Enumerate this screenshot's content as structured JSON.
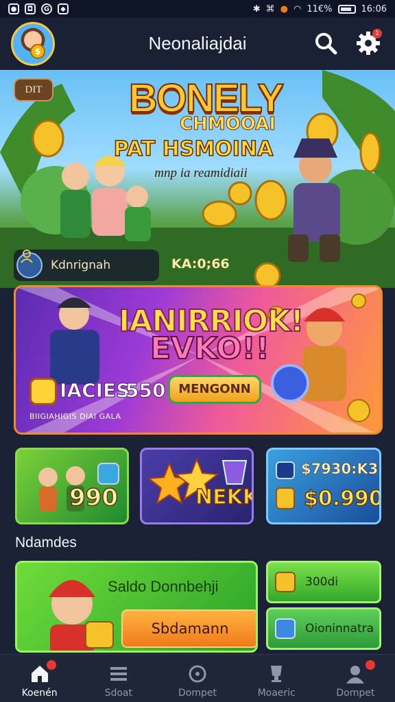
{
  "status_bar": {
    "left_icons": [
      "notification-icon",
      "app-icon",
      "google-icon",
      "messenger-icon"
    ],
    "right_text": "11€%",
    "time": "16:06"
  },
  "header": {
    "title": "Neonaliajdai",
    "search_icon": "search-icon",
    "settings_icon": "gear-icon",
    "settings_badge": "1"
  },
  "hero": {
    "tag": "DIT",
    "title": "BONELY",
    "subtitle_1": "CHMOOAI",
    "subtitle_2": "PAT HSMOINA",
    "subtitle_3": "mnp ia reamidiaii",
    "player_name": "Kdnrignah",
    "player_value": "KA:0;66"
  },
  "promo": {
    "title_1": "IANIRRIOK!",
    "title_2": "EVKO!!",
    "label": "IACIES",
    "value": "550",
    "button": "MENGONN",
    "fine_print": "BIIGIAHIGIS DIAI GALA"
  },
  "tiles": [
    {
      "value": "990"
    },
    {
      "value": "NEKK"
    },
    {
      "top": "$7930:K3",
      "value": "$0.990"
    }
  ],
  "section": {
    "title": "Ndamdes"
  },
  "cards": {
    "big_title": "Saldo Donnbehji",
    "orange_button": "Sbdamann",
    "small_1": "300di",
    "small_2": "Oioninnatra"
  },
  "bottom_nav": [
    {
      "label": "Koenén",
      "icon": "home-icon",
      "active": true,
      "badge": true
    },
    {
      "label": "Sdoat",
      "icon": "menu-icon",
      "active": false,
      "badge": false
    },
    {
      "label": "Dompet",
      "icon": "wallet-icon",
      "active": false,
      "badge": false
    },
    {
      "label": "Moaeric",
      "icon": "trophy-icon",
      "active": false,
      "badge": false
    },
    {
      "label": "Dompet",
      "icon": "profile-icon",
      "active": false,
      "badge": true
    }
  ],
  "colors": {
    "background": "#1b2236",
    "accent_gold": "#ffc832",
    "accent_green": "#6fdc3a",
    "badge_red": "#e53935"
  }
}
